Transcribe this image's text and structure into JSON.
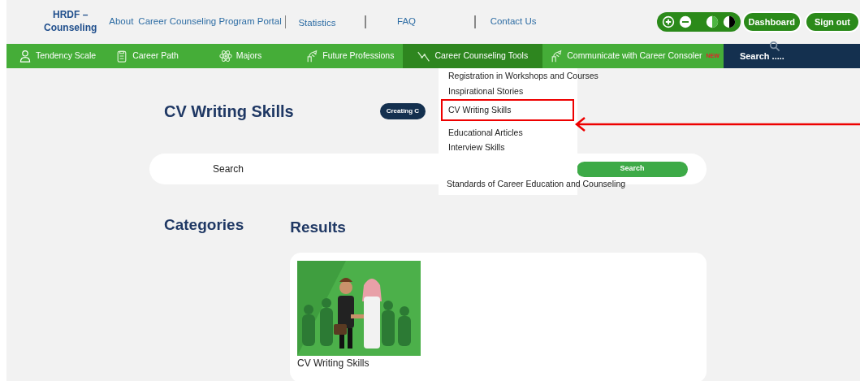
{
  "brand": {
    "line1": "HRDF –",
    "line2": "Counseling"
  },
  "top_links": [
    {
      "label": "About"
    },
    {
      "label": "Career Counseling Program Portal"
    },
    {
      "label": "Statistics"
    },
    {
      "label": "FAQ"
    },
    {
      "label": "Contact Us"
    }
  ],
  "accessibility": [
    {
      "kind": "plus"
    },
    {
      "kind": "minus"
    },
    {
      "kind": "contrast-light"
    },
    {
      "kind": "contrast-dark"
    }
  ],
  "top_buttons": [
    {
      "label": "Dashboard"
    },
    {
      "label": "Sign out"
    }
  ],
  "nav": [
    {
      "label": "Tendency Scale",
      "kind": "person",
      "expanded": false
    },
    {
      "label": "Career Path",
      "kind": "clipboard",
      "expanded": false
    },
    {
      "label": "Majors",
      "kind": "atom",
      "expanded": false
    },
    {
      "label": "Future Professions",
      "kind": "sprout",
      "expanded": false
    },
    {
      "label": "Career Counseling  Tools",
      "kind": "graph",
      "expanded": true
    },
    {
      "label": "Communicate with Career Consoler",
      "kind": "sprout",
      "expanded": false,
      "badge": "NEW"
    }
  ],
  "nav_search": {
    "placeholder": "Search ....."
  },
  "dropdown": [
    {
      "label": "Registration in Workshops and Courses",
      "annotated": false
    },
    {
      "label": "Inspirational Stories",
      "annotated": false
    },
    {
      "label": "CV Writing Skills",
      "annotated": true
    },
    {
      "label": "Educational Articles",
      "annotated": false
    },
    {
      "label": "Interview Skills",
      "annotated": false
    },
    {
      "label": "Standards of Career Education and Counseling",
      "annotated": false
    }
  ],
  "page_title": "CV Writing Skills",
  "tag": "Creating C",
  "search": {
    "placeholder": "Search",
    "button": "Search"
  },
  "categories_heading": "Categories",
  "results_heading": "Results",
  "results": [
    {
      "kind": "picture",
      "title": "CV Writing Skills"
    }
  ]
}
